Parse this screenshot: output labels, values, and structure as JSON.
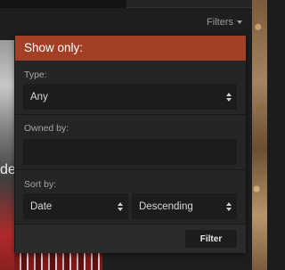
{
  "filters_toggle": {
    "label": "Filters"
  },
  "panel": {
    "title": "Show only:",
    "type": {
      "label": "Type:",
      "value": "Any"
    },
    "owned_by": {
      "label": "Owned by:",
      "value": ""
    },
    "sort": {
      "label": "Sort by:",
      "field": "Date",
      "order": "Descending"
    },
    "submit_label": "Filter"
  },
  "background": {
    "card_text": "der"
  },
  "colors": {
    "header_bg": "#a23f25",
    "panel_bg": "#252525",
    "field_bg": "#1c1c1c"
  }
}
